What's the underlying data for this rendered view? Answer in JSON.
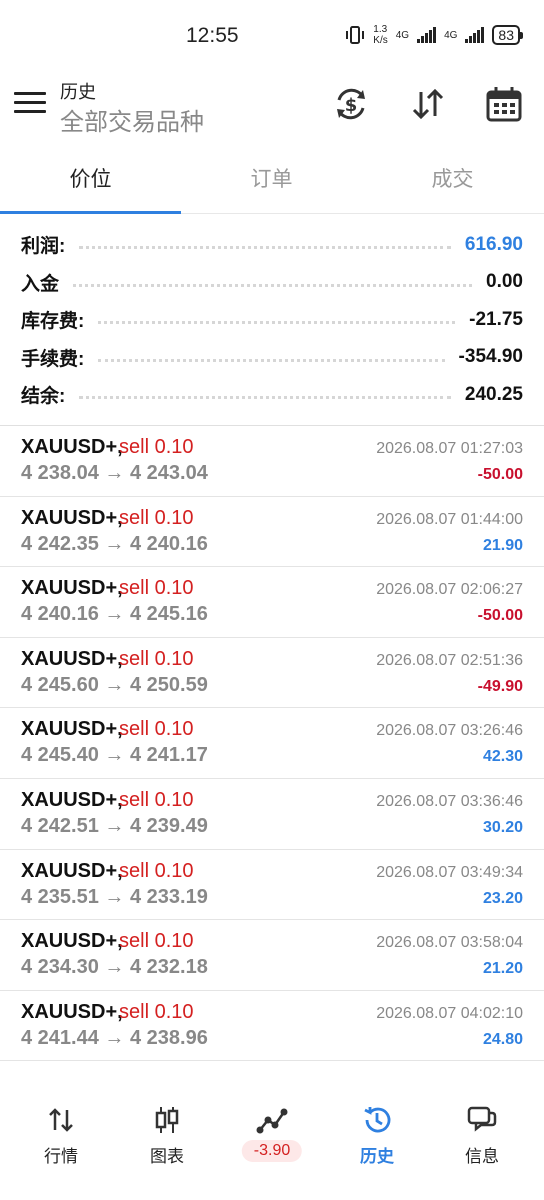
{
  "status_bar": {
    "time": "12:55",
    "net_speed_top": "1.3",
    "net_speed_bottom": "K/s",
    "network_1": "4G",
    "network_2": "4G",
    "battery": "83"
  },
  "toolbar": {
    "title": "历史",
    "subtitle": "全部交易品种"
  },
  "tabs": [
    "价位",
    "订单",
    "成交"
  ],
  "summary": [
    {
      "label": "利润:",
      "value": "616.90",
      "highlight": true
    },
    {
      "label": "入金",
      "value": "0.00",
      "highlight": false
    },
    {
      "label": "库存费:",
      "value": "-21.75",
      "highlight": false
    },
    {
      "label": "手续费:",
      "value": "-354.90",
      "highlight": false
    },
    {
      "label": "结余:",
      "value": "240.25",
      "highlight": false
    }
  ],
  "trades": [
    {
      "symbol": "XAUUSD+,",
      "side": "sell 0.10",
      "prices": "4 238.04 → 4 243.04",
      "time": "2026.08.07 01:27:03",
      "profit": "-50.00",
      "positive": false
    },
    {
      "symbol": "XAUUSD+,",
      "side": "sell 0.10",
      "prices": "4 242.35 → 4 240.16",
      "time": "2026.08.07 01:44:00",
      "profit": "21.90",
      "positive": true
    },
    {
      "symbol": "XAUUSD+,",
      "side": "sell 0.10",
      "prices": "4 240.16 → 4 245.16",
      "time": "2026.08.07 02:06:27",
      "profit": "-50.00",
      "positive": false
    },
    {
      "symbol": "XAUUSD+,",
      "side": "sell 0.10",
      "prices": "4 245.60 → 4 250.59",
      "time": "2026.08.07 02:51:36",
      "profit": "-49.90",
      "positive": false
    },
    {
      "symbol": "XAUUSD+,",
      "side": "sell 0.10",
      "prices": "4 245.40 → 4 241.17",
      "time": "2026.08.07 03:26:46",
      "profit": "42.30",
      "positive": true
    },
    {
      "symbol": "XAUUSD+,",
      "side": "sell 0.10",
      "prices": "4 242.51 → 4 239.49",
      "time": "2026.08.07 03:36:46",
      "profit": "30.20",
      "positive": true
    },
    {
      "symbol": "XAUUSD+,",
      "side": "sell 0.10",
      "prices": "4 235.51 → 4 233.19",
      "time": "2026.08.07 03:49:34",
      "profit": "23.20",
      "positive": true
    },
    {
      "symbol": "XAUUSD+,",
      "side": "sell 0.10",
      "prices": "4 234.30 → 4 232.18",
      "time": "2026.08.07 03:58:04",
      "profit": "21.20",
      "positive": true
    },
    {
      "symbol": "XAUUSD+,",
      "side": "sell 0.10",
      "prices": "4 241.44 → 4 238.96",
      "time": "2026.08.07 04:02:10",
      "profit": "24.80",
      "positive": true
    }
  ],
  "bottom_nav": [
    {
      "label": "行情",
      "icon": "quotes-arrows-icon",
      "active": false
    },
    {
      "label": "图表",
      "icon": "candlestick-icon",
      "active": false
    },
    {
      "label": "-3.90",
      "icon": "trade-line-icon",
      "active": false,
      "badge": true
    },
    {
      "label": "历史",
      "icon": "history-clock-icon",
      "active": true
    },
    {
      "label": "信息",
      "icon": "messages-icon",
      "active": false
    }
  ],
  "colors": {
    "accent": "#2f80e0",
    "loss": "#c8102e",
    "sell": "#d42020"
  }
}
